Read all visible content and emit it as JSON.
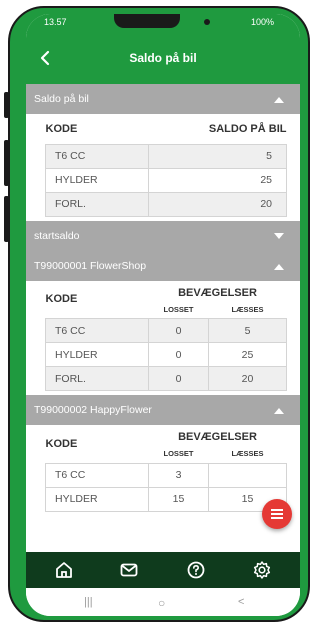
{
  "colors": {
    "brand_green": "#1f9a3f",
    "nav_dark": "#0f3b1d",
    "section_gray": "#a8a8a8",
    "fab_red": "#e53935"
  },
  "status_bar": {
    "time": "13.57",
    "battery": "100%"
  },
  "header": {
    "title": "Saldo på bil",
    "back_icon": "chevron-left-icon"
  },
  "sections": {
    "saldo": {
      "title": "Saldo på bil",
      "expanded": true,
      "col_code": "KODE",
      "col_saldo": "SALDO PÅ BIL",
      "rows": [
        {
          "code": "T6 CC",
          "saldo": "5"
        },
        {
          "code": "HYLDER",
          "saldo": "25"
        },
        {
          "code": "FORL.",
          "saldo": "20"
        }
      ]
    },
    "startsaldo": {
      "title": "startsaldo",
      "expanded": false
    },
    "flowershop": {
      "title": "T99000001 FlowerShop",
      "expanded": true,
      "col_code": "KODE",
      "col_movements": "BEVÆGELSER",
      "col_unloaded": "LOSSET",
      "col_loaded": "LÆSSES",
      "rows": [
        {
          "code": "T6 CC",
          "unloaded": "0",
          "loaded": "5"
        },
        {
          "code": "HYLDER",
          "unloaded": "0",
          "loaded": "25"
        },
        {
          "code": "FORL.",
          "unloaded": "0",
          "loaded": "20"
        }
      ]
    },
    "happyflower": {
      "title": "T99000002 HappyFlower",
      "expanded": true,
      "col_code": "KODE",
      "col_movements": "BEVÆGELSER",
      "col_unloaded": "LOSSET",
      "col_loaded": "LÆSSES",
      "rows": [
        {
          "code": "T6 CC",
          "unloaded": "3",
          "loaded": ""
        },
        {
          "code": "HYLDER",
          "unloaded": "15",
          "loaded": "15"
        }
      ]
    }
  },
  "fab": {
    "icon": "menu-icon"
  },
  "bottom_nav": [
    {
      "icon": "home-icon"
    },
    {
      "icon": "mail-icon"
    },
    {
      "icon": "help-icon"
    },
    {
      "icon": "settings-icon"
    }
  ],
  "system_nav": {
    "recent": "|||",
    "home": "○",
    "back": "<"
  }
}
